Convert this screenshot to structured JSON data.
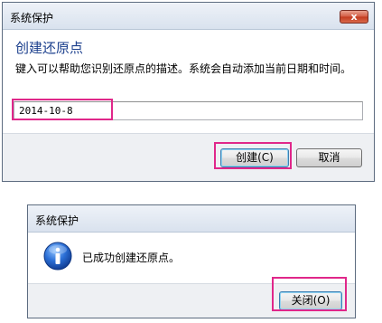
{
  "create_dialog": {
    "title": "系统保护",
    "close_glyph": "x",
    "heading": "创建还原点",
    "description": "键入可以帮助您识别还原点的描述。系统会自动添加当前日期和时间。",
    "restore_point_name": "2014-10-8",
    "create_button_label": "创建(C)",
    "cancel_button_label": "取消"
  },
  "success_dialog": {
    "title": "系统保护",
    "icon": "info-icon",
    "message": "已成功创建还原点。",
    "close_button_label": "关闭(O)"
  },
  "colors": {
    "highlight": "#e0278a",
    "heading": "#1a3e8c",
    "close_button": "#c33b1f"
  }
}
